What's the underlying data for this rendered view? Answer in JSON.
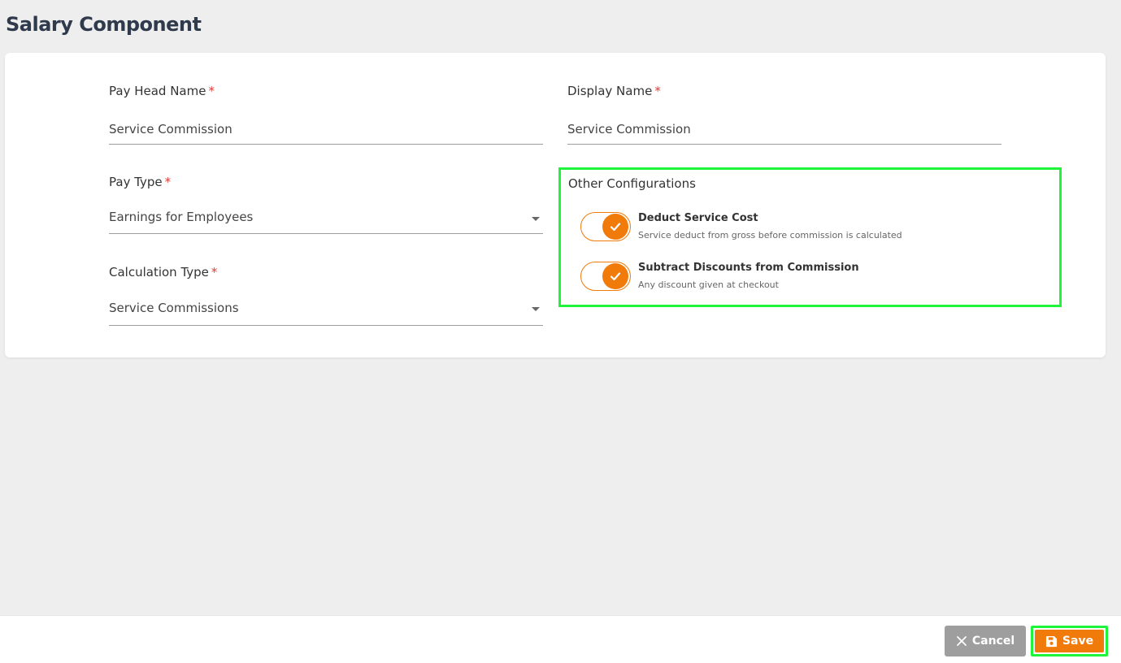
{
  "page": {
    "title": "Salary Component"
  },
  "form": {
    "pay_head_name": {
      "label": "Pay Head Name",
      "required": "*",
      "value": "Service Commission"
    },
    "display_name": {
      "label": "Display Name",
      "required": "*",
      "value": "Service Commission"
    },
    "pay_type": {
      "label": "Pay Type",
      "required": "*",
      "value": "Earnings for Employees"
    },
    "calculation_type": {
      "label": "Calculation Type",
      "required": "*",
      "value": "Service Commissions"
    }
  },
  "other_configurations": {
    "title": "Other Configurations",
    "toggles": [
      {
        "title": "Deduct Service Cost",
        "description": "Service deduct from gross before commission is calculated",
        "checked": true
      },
      {
        "title": "Subtract Discounts from Commission",
        "description": "Any discount given at checkout",
        "checked": true
      }
    ]
  },
  "footer": {
    "cancel_label": "Cancel",
    "save_label": "Save"
  },
  "colors": {
    "accent": "#f07a0a",
    "highlight": "#1ef53a",
    "cancel": "#9e9e9e",
    "required": "#e53935"
  }
}
